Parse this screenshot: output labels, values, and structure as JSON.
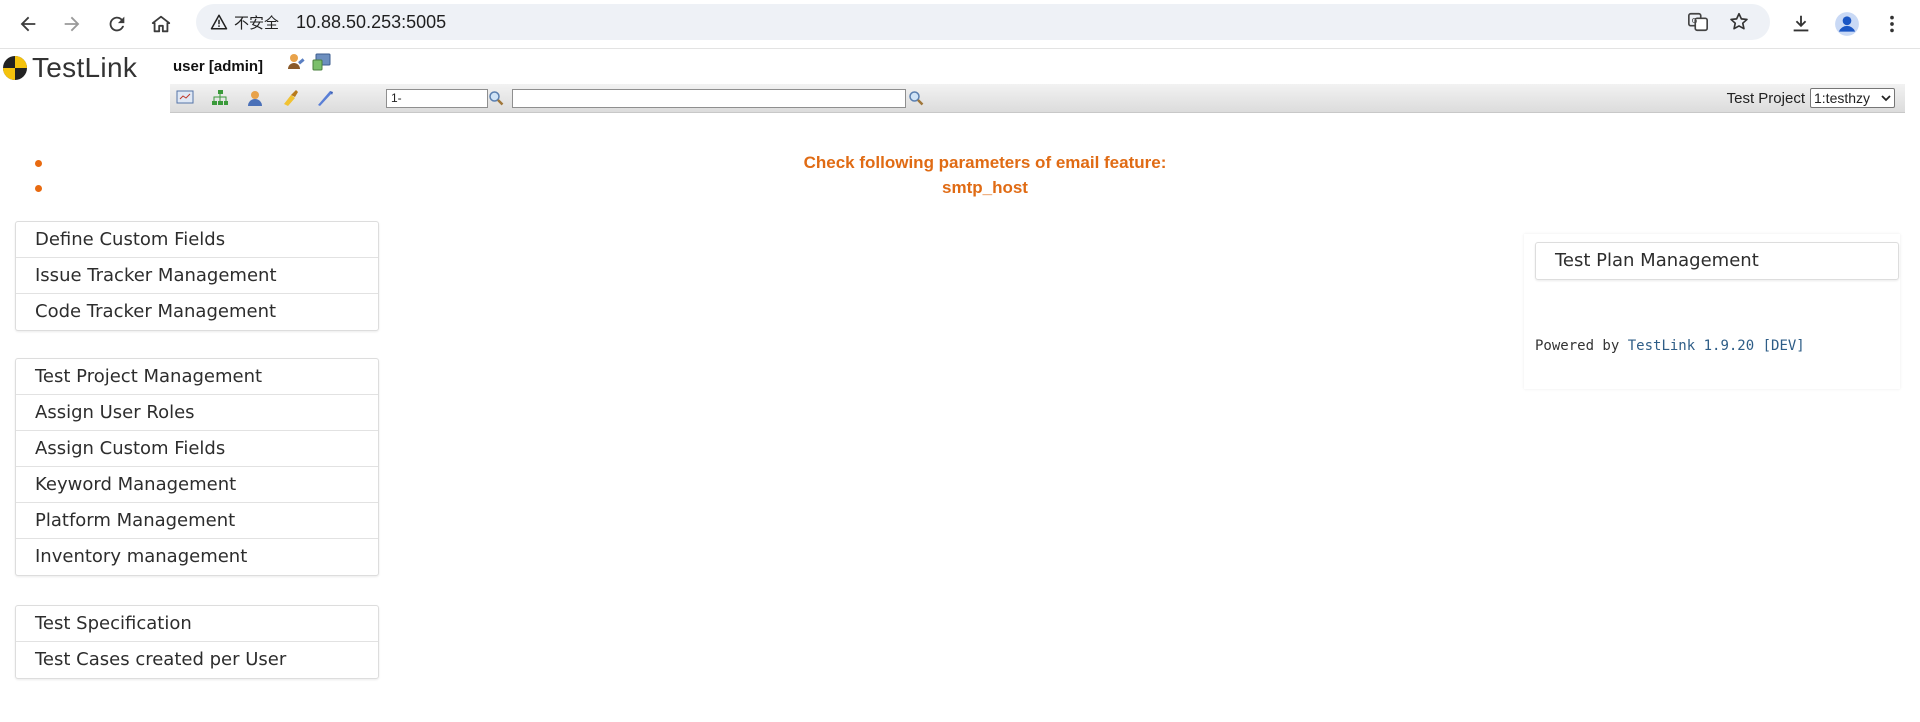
{
  "browser": {
    "security_label": "不安全",
    "url": "10.88.50.253:5005"
  },
  "app": {
    "logo_text": "TestLink",
    "user_text": "user [admin]"
  },
  "toolbar": {
    "testcase_id_value": "1-",
    "search_value": "",
    "project_label": "Test Project",
    "project_selected": "1:testhzy"
  },
  "messages": [
    "Check following parameters of email feature:",
    "smtp_host"
  ],
  "menu_system": [
    "Define Custom Fields",
    "Issue Tracker Management",
    "Code Tracker Management"
  ],
  "menu_project": [
    "Test Project Management",
    "Assign User Roles",
    "Assign Custom Fields",
    "Keyword Management",
    "Platform Management",
    "Inventory management"
  ],
  "menu_spec": [
    "Test Specification",
    "Test Cases created per User"
  ],
  "right_menu": [
    "Test Plan Management"
  ],
  "footer": {
    "powered_prefix": "Powered by",
    "powered_link": "TestLink 1.9.20 [DEV]"
  },
  "colors": {
    "message": "#e06b14",
    "link": "#2e5d87",
    "toolbar_bg": "#dcdcdc"
  }
}
